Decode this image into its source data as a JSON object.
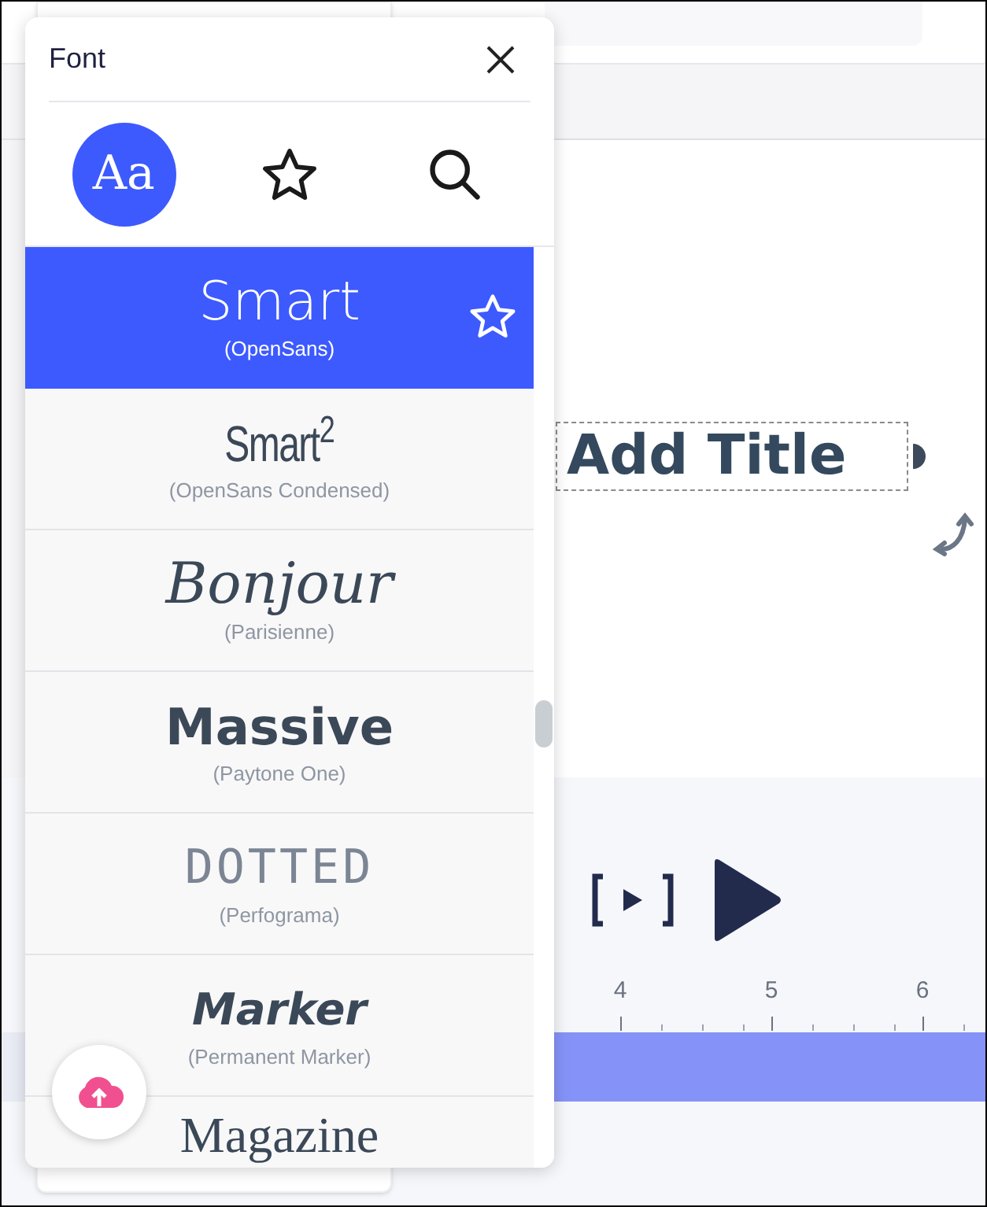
{
  "font_panel": {
    "title": "Font",
    "tabs": [
      {
        "kind": "all",
        "label": "Aa",
        "selected": true
      },
      {
        "kind": "favorites",
        "selected": false
      },
      {
        "kind": "search",
        "selected": false
      }
    ],
    "fonts": [
      {
        "kind": "opensans",
        "name": "Smart",
        "source": "(OpenSans)",
        "selected": true
      },
      {
        "kind": "condensed",
        "name": "Smart$^{2}$",
        "source": "(OpenSans Condensed)",
        "selected": false
      },
      {
        "kind": "script",
        "name": "Bonjour",
        "source": "(Parisienne)",
        "selected": false
      },
      {
        "kind": "massive",
        "name": "Massive",
        "source": "(Paytone One)",
        "selected": false
      },
      {
        "kind": "dotted",
        "name": "DOTTED",
        "source": "(Perfograma)",
        "selected": false
      },
      {
        "kind": "marker",
        "name": "Marker",
        "source": "(Permanent Marker)",
        "selected": false
      },
      {
        "kind": "serif",
        "name": "Magazine",
        "selected": false
      }
    ]
  },
  "canvas": {
    "title_placeholder": "Add Title"
  },
  "timeline": {
    "ruler_labels": [
      "4",
      "5",
      "6"
    ]
  }
}
